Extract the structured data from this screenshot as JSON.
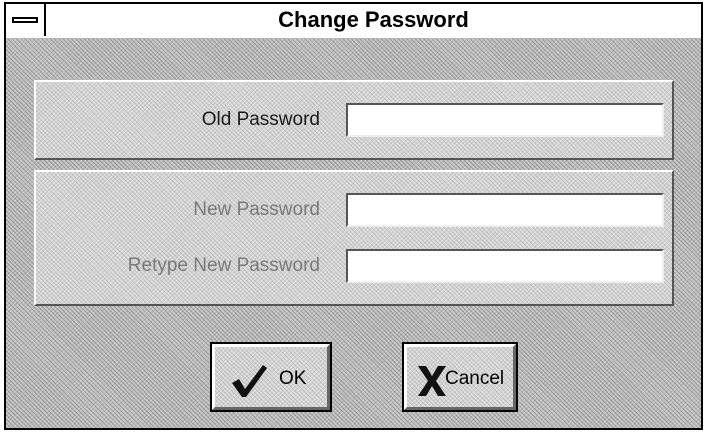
{
  "window": {
    "title": "Change Password"
  },
  "form": {
    "old_password_label": "Old Password",
    "old_password_value": "",
    "new_password_label": "New Password",
    "new_password_value": "",
    "retype_password_label": "Retype New Password",
    "retype_password_value": ""
  },
  "buttons": {
    "ok_label": "OK",
    "ok_icon": "checkmark-icon",
    "cancel_label": "Cancel",
    "cancel_icon": "x-icon"
  }
}
